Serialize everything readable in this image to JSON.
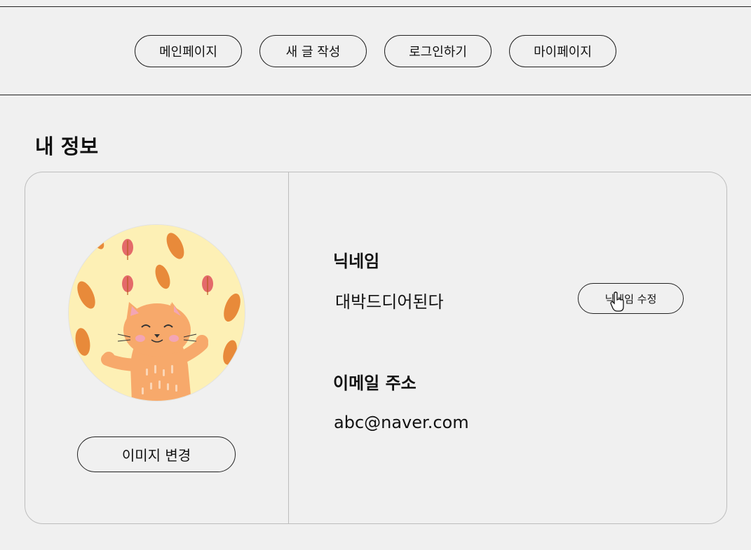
{
  "nav": {
    "items": [
      {
        "label": "메인페이지"
      },
      {
        "label": "새 글 작성"
      },
      {
        "label": "로그인하기"
      },
      {
        "label": "마이페이지"
      }
    ]
  },
  "profile": {
    "section_title": "내 정보",
    "avatar_icon": "cat-illustration",
    "change_image_label": "이미지 변경",
    "nickname_label": "닉네임",
    "nickname_value": "대박드디어된다",
    "edit_nickname_label": "닉네임 수정",
    "email_label": "이메일 주소",
    "email_value": "abc@naver.com"
  },
  "colors": {
    "background": "#f0f0f0",
    "border": "#bdbdbd",
    "text": "#111111",
    "avatar_bg": "#fdf0b5",
    "cat": "#f7a96b",
    "leaf_orange": "#e88a3a",
    "leaf_red": "#e46a6a"
  }
}
